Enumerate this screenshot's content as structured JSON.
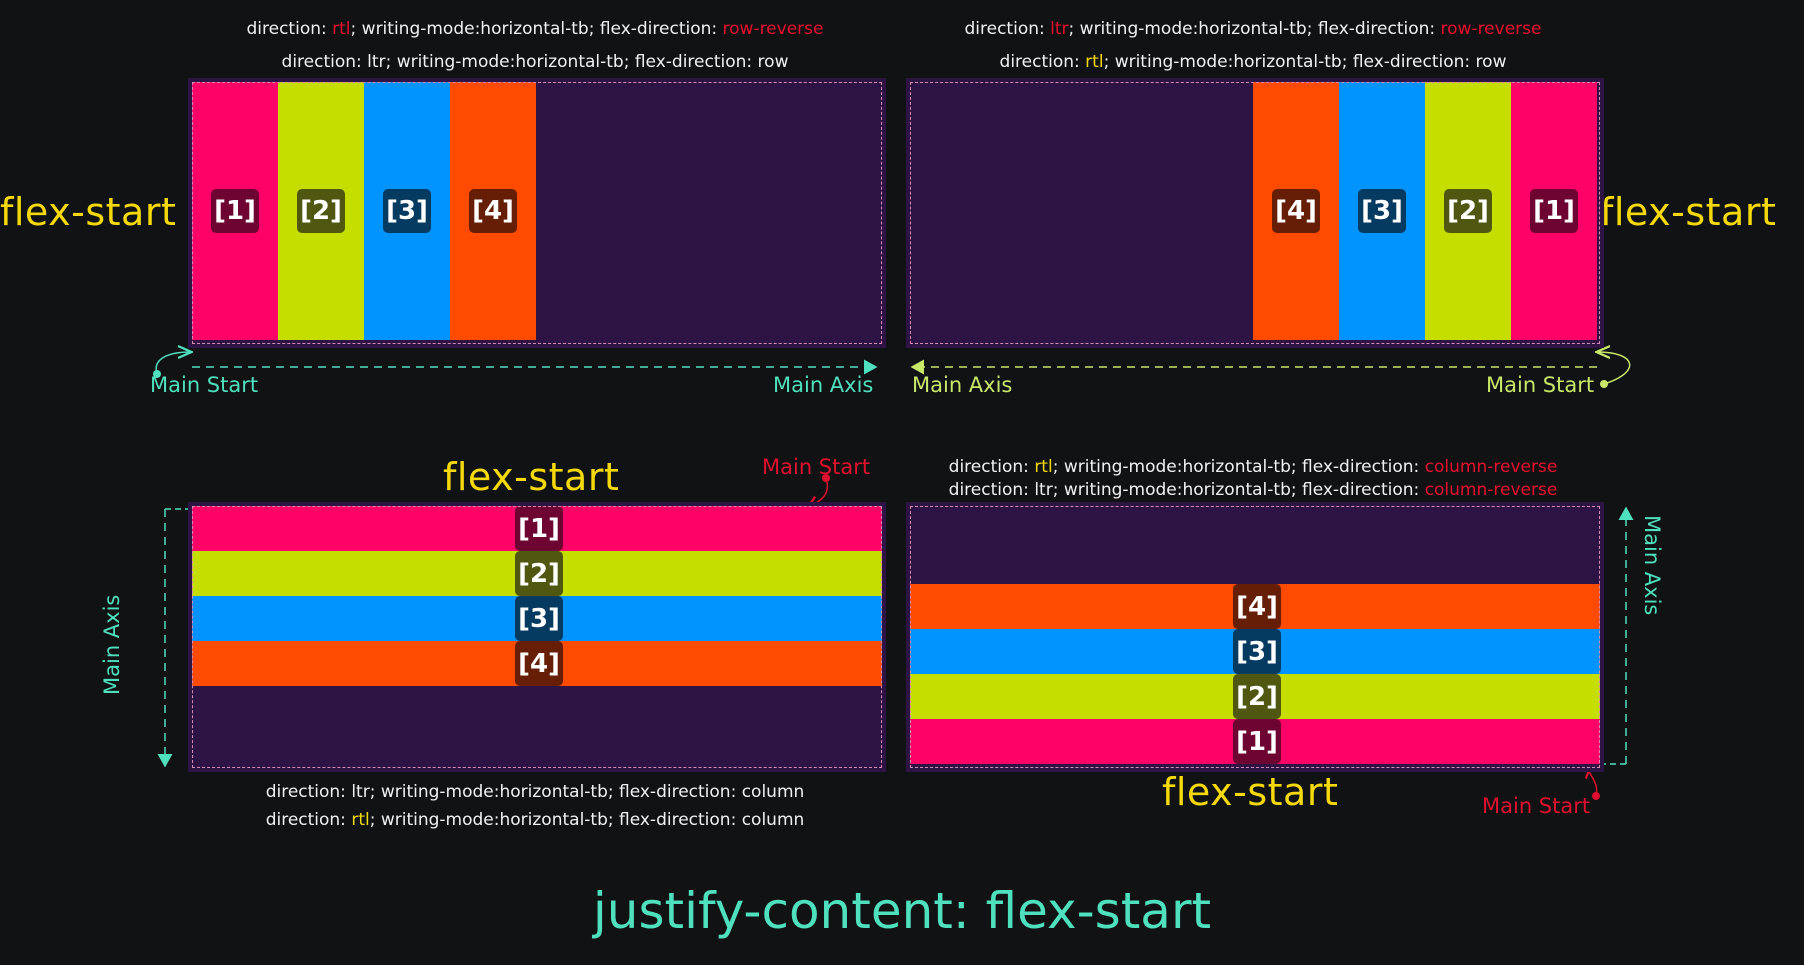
{
  "title": "justify-content: flex-start",
  "quadrants": {
    "tl": {
      "cap1": {
        "pre": "direction: ",
        "dir": "rtl",
        "mid": "; writing-mode:horizontal-tb; flex-direction: ",
        "flex": "row-reverse"
      },
      "cap2": {
        "pre": "direction: ",
        "dir": "ltr",
        "mid": "; writing-mode:horizontal-tb; flex-direction: ",
        "flex": "row"
      },
      "label": "flex-start",
      "main_start": "Main Start",
      "main_axis": "Main Axis"
    },
    "tr": {
      "cap1": {
        "pre": "direction: ",
        "dir": "ltr",
        "mid": "; writing-mode:horizontal-tb; flex-direction: ",
        "flex": "row-reverse"
      },
      "cap2": {
        "pre": "direction: ",
        "dir": "rtl",
        "mid": "; writing-mode:horizontal-tb; flex-direction: ",
        "flex": "row"
      },
      "label": "flex-start",
      "main_start": "Main Start",
      "main_axis": "Main Axis"
    },
    "bl": {
      "cap1": {
        "pre": "direction: ",
        "dir": "ltr",
        "mid": "; writing-mode:horizontal-tb; flex-direction: ",
        "flex": "column"
      },
      "cap2": {
        "pre": "direction: ",
        "dir": "rtl",
        "mid": "; writing-mode:horizontal-tb; flex-direction: ",
        "flex": "column"
      },
      "label": "flex-start",
      "main_start": "Main Start",
      "main_axis": "Main Axis"
    },
    "br": {
      "cap1": {
        "pre": "direction: ",
        "dir": "rtl",
        "mid": "; writing-mode:horizontal-tb; flex-direction: ",
        "flex": "column-reverse"
      },
      "cap2": {
        "pre": "direction: ",
        "dir": "ltr",
        "mid": "; writing-mode:horizontal-tb; flex-direction: ",
        "flex": "column-reverse"
      },
      "label": "flex-start",
      "main_start": "Main Start",
      "main_axis": "Main Axis"
    }
  },
  "items": {
    "i1": "[1]",
    "i2": "[2]",
    "i3": "[3]",
    "i4": "[4]"
  },
  "colors": {
    "item1": "#ff0268",
    "item2": "#c6dd00",
    "item3": "#0194fe",
    "item4": "#ff4b00",
    "container": "#2e1444",
    "label": "#f5d90a",
    "axis_teal": "#4fe0bd",
    "axis_lime": "#c9e86a",
    "accent_red": "#e8102e"
  }
}
